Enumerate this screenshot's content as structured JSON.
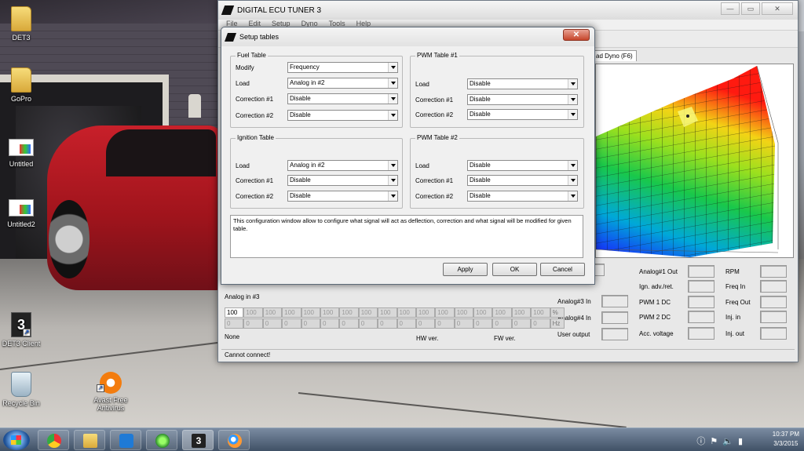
{
  "desktop": {
    "icons": [
      {
        "label": "DET3",
        "kind": "folder",
        "icon": "folder-icon"
      },
      {
        "label": "GoPro",
        "kind": "folder",
        "icon": "folder-icon"
      },
      {
        "label": "Untitled",
        "kind": "file",
        "icon": "image-file-icon"
      },
      {
        "label": "Untitled2",
        "kind": "file",
        "icon": "image-file-icon"
      },
      {
        "label": "DET3 Client",
        "kind": "shortcut",
        "icon": "det3-app-icon"
      },
      {
        "label": "Recycle Bin",
        "kind": "system",
        "icon": "recycle-bin-icon"
      },
      {
        "label": "Avast Free Antivirus",
        "kind": "shortcut",
        "icon": "avast-icon"
      }
    ]
  },
  "main_window": {
    "title": "DIGITAL ECU TUNER 3",
    "menu": [
      "File",
      "Edit",
      "Setup",
      "Dyno",
      "Tools",
      "Help"
    ],
    "dyno_tab": "ad Dyno (F6)",
    "analog_label": "Analog in #3",
    "grid_row1": [
      "100",
      "100",
      "100",
      "100",
      "100",
      "100",
      "100",
      "100",
      "100",
      "100",
      "100",
      "100",
      "100",
      "100",
      "100",
      "100",
      "100"
    ],
    "grid_row1_unit": "%",
    "grid_row2": [
      "0",
      "0",
      "0",
      "0",
      "0",
      "0",
      "0",
      "0",
      "0",
      "0",
      "0",
      "0",
      "0",
      "0",
      "0",
      "0",
      "0"
    ],
    "grid_row2_unit": "Hz",
    "info": {
      "none": "None",
      "hw": "HW ver.",
      "fw": "FW ver."
    },
    "status": "Cannot connect!",
    "gauges": {
      "col1": [
        "Analog#3 In",
        "Analog#4 In",
        "User output"
      ],
      "col2": [
        "Analog#1 Out",
        "Ign. adv./ret.",
        "PWM 1 DC",
        "PWM 2 DC",
        "Acc. voltage"
      ],
      "col3": [
        "RPM",
        "Freq In",
        "Freq Out",
        "Inj. in",
        "Inj. out"
      ]
    }
  },
  "dialog": {
    "title": "Setup tables",
    "close": "✕",
    "fuel": {
      "title": "Fuel Table",
      "rows": [
        {
          "label": "Modify",
          "value": "Frequency"
        },
        {
          "label": "Load",
          "value": "Analog in #2"
        },
        {
          "label": "Correction #1",
          "value": "Disable"
        },
        {
          "label": "Correction #2",
          "value": "Disable"
        }
      ]
    },
    "pwm1": {
      "title": "PWM Table #1",
      "rows": [
        {
          "label": "Load",
          "value": "Disable"
        },
        {
          "label": "Correction #1",
          "value": "Disable"
        },
        {
          "label": "Correction #2",
          "value": "Disable"
        }
      ]
    },
    "ignition": {
      "title": "Ignition Table",
      "rows": [
        {
          "label": "Load",
          "value": "Analog in #2"
        },
        {
          "label": "Correction #1",
          "value": "Disable"
        },
        {
          "label": "Correction #2",
          "value": "Disable"
        }
      ]
    },
    "pwm2": {
      "title": "PWM Table #2",
      "rows": [
        {
          "label": "Load",
          "value": "Disable"
        },
        {
          "label": "Correction #1",
          "value": "Disable"
        },
        {
          "label": "Correction #2",
          "value": "Disable"
        }
      ]
    },
    "description": "This configuration window allow to configure what signal will act as deflection, correction and what signal will be modified for given table.",
    "buttons": {
      "apply": "Apply",
      "ok": "OK",
      "cancel": "Cancel"
    }
  },
  "taskbar": {
    "time": "10:37 PM",
    "date": "3/3/2015"
  }
}
